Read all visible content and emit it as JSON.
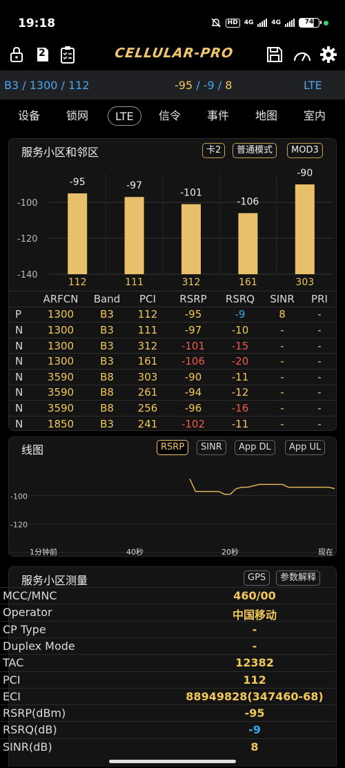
{
  "status_bar": {
    "time": "19:18",
    "hd_label": "HD",
    "net1": "4G",
    "net2": "4G",
    "battery": "74"
  },
  "toolbar": {
    "brand": "CELLULAR-PRO",
    "sim_badge": "2",
    "icons": [
      "lock-icon",
      "sim-2-icon",
      "clipboard-icon",
      "save-icon",
      "speedometer-icon",
      "gear-icon"
    ]
  },
  "info_line": {
    "band_channel": "B3 / 1300 / 112",
    "signal_p1": "-95",
    "sep1": " / ",
    "signal_p2": "-9",
    "sep2": " / ",
    "signal_p3": "8",
    "tech": "LTE",
    "colors": {
      "band": "#4aa8f0",
      "rsrp": "#f2c85b",
      "rsrq": "#39a7f0",
      "sinr": "#f2c85b",
      "tech": "#4aa8f0"
    }
  },
  "tabs": [
    {
      "label": "设备",
      "active": false
    },
    {
      "label": "锁网",
      "active": false
    },
    {
      "label": "LTE",
      "active": true
    },
    {
      "label": "信令",
      "active": false
    },
    {
      "label": "事件",
      "active": false
    },
    {
      "label": "地图",
      "active": false
    },
    {
      "label": "室内",
      "active": false
    }
  ],
  "serving_panel": {
    "title": "服务小区和邻区",
    "chips": [
      "卡2",
      "普通模式",
      "MOD3"
    ]
  },
  "chart_data": [
    {
      "type": "bar",
      "title": "",
      "categories": [
        "112",
        "111",
        "312",
        "161",
        "303"
      ],
      "values": [
        -95,
        -97,
        -101,
        -106,
        -90
      ],
      "value_labels": [
        "-95",
        "-97",
        "-101",
        "-106",
        "-90"
      ],
      "ylim": [
        -140,
        -80
      ],
      "yticks": [
        "-100",
        "-120",
        "-140"
      ],
      "grid": true,
      "bar_color": "#e8c06b"
    },
    {
      "type": "line",
      "series": [
        {
          "values": [
            -88,
            -97,
            -97,
            -97,
            -97,
            -97,
            -99,
            -99,
            -95,
            -94,
            -94,
            -93,
            -92,
            -92,
            -92,
            -92,
            -92,
            -94,
            -94,
            -94,
            -94,
            -94,
            -94,
            -94,
            -94,
            -95
          ]
        }
      ],
      "ylim": [
        -140,
        -80
      ],
      "yticks": [
        "-100",
        "-120"
      ],
      "xticks": [
        "1分钟前",
        "40秒",
        "20秒",
        "现在"
      ],
      "line_color": "#e0b45a"
    }
  ],
  "neighbor_table": {
    "headers": [
      "",
      "ARFCN",
      "Band",
      "PCI",
      "RSRP",
      "RSRQ",
      "SINR",
      "PRI"
    ],
    "rows": [
      {
        "type": "P",
        "arfcn": "1300",
        "band": "B3",
        "pci": "112",
        "rsrp": "-95",
        "rsrq": "-9",
        "sinr": "8",
        "pri": "-",
        "rsrp_c": "yel",
        "rsrq_c": "blu",
        "sinr_c": "yel"
      },
      {
        "type": "N",
        "arfcn": "1300",
        "band": "B3",
        "pci": "111",
        "rsrp": "-97",
        "rsrq": "-10",
        "sinr": "-",
        "pri": "-",
        "rsrp_c": "yel",
        "rsrq_c": "yel",
        "sinr_c": "yel"
      },
      {
        "type": "N",
        "arfcn": "1300",
        "band": "B3",
        "pci": "312",
        "rsrp": "-101",
        "rsrq": "-15",
        "sinr": "-",
        "pri": "-",
        "rsrp_c": "red",
        "rsrq_c": "red",
        "sinr_c": "yel"
      },
      {
        "type": "N",
        "arfcn": "1300",
        "band": "B3",
        "pci": "161",
        "rsrp": "-106",
        "rsrq": "-20",
        "sinr": "-",
        "pri": "-",
        "rsrp_c": "red",
        "rsrq_c": "red",
        "sinr_c": "yel"
      },
      {
        "type": "N",
        "arfcn": "3590",
        "band": "B8",
        "pci": "303",
        "rsrp": "-90",
        "rsrq": "-11",
        "sinr": "-",
        "pri": "-",
        "rsrp_c": "yel",
        "rsrq_c": "yel",
        "sinr_c": "yel"
      },
      {
        "type": "N",
        "arfcn": "3590",
        "band": "B8",
        "pci": "261",
        "rsrp": "-94",
        "rsrq": "-12",
        "sinr": "-",
        "pri": "-",
        "rsrp_c": "yel",
        "rsrq_c": "yel",
        "sinr_c": "yel"
      },
      {
        "type": "N",
        "arfcn": "3590",
        "band": "B8",
        "pci": "256",
        "rsrp": "-96",
        "rsrq": "-16",
        "sinr": "-",
        "pri": "-",
        "rsrp_c": "yel",
        "rsrq_c": "red",
        "sinr_c": "yel"
      },
      {
        "type": "N",
        "arfcn": "1850",
        "band": "B3",
        "pci": "241",
        "rsrp": "-102",
        "rsrq": "-11",
        "sinr": "-",
        "pri": "-",
        "rsrp_c": "red",
        "rsrq_c": "yel",
        "sinr_c": "yel"
      }
    ]
  },
  "line_panel": {
    "title": "线图",
    "chips": [
      {
        "label": "RSRP",
        "selected": true
      },
      {
        "label": "SINR",
        "selected": false
      },
      {
        "label": "App DL",
        "selected": false
      },
      {
        "label": "App UL",
        "selected": false
      }
    ]
  },
  "measure_panel": {
    "title": "服务小区测量",
    "chips": [
      "GPS",
      "参数解释"
    ],
    "rows": [
      {
        "key": "MCC/MNC",
        "value": "460/00",
        "color": "#f2c85b"
      },
      {
        "key": "Operator",
        "value": "中国移动",
        "color": "#f2c85b"
      },
      {
        "key": "CP Type",
        "value": "-",
        "color": "#f2c85b"
      },
      {
        "key": "Duplex Mode",
        "value": "-",
        "color": "#f2c85b"
      },
      {
        "key": "TAC",
        "value": "12382",
        "color": "#f2c85b"
      },
      {
        "key": "PCI",
        "value": "112",
        "color": "#f2c85b"
      },
      {
        "key": "ECI",
        "value": "88949828(347460-68)",
        "color": "#f2c85b"
      },
      {
        "key": "RSRP(dBm)",
        "value": "-95",
        "color": "#f2c85b"
      },
      {
        "key": "RSRQ(dB)",
        "value": "-9",
        "color": "#39a7f0"
      },
      {
        "key": "SINR(dB)",
        "value": "8",
        "color": "#f2c85b"
      }
    ]
  }
}
